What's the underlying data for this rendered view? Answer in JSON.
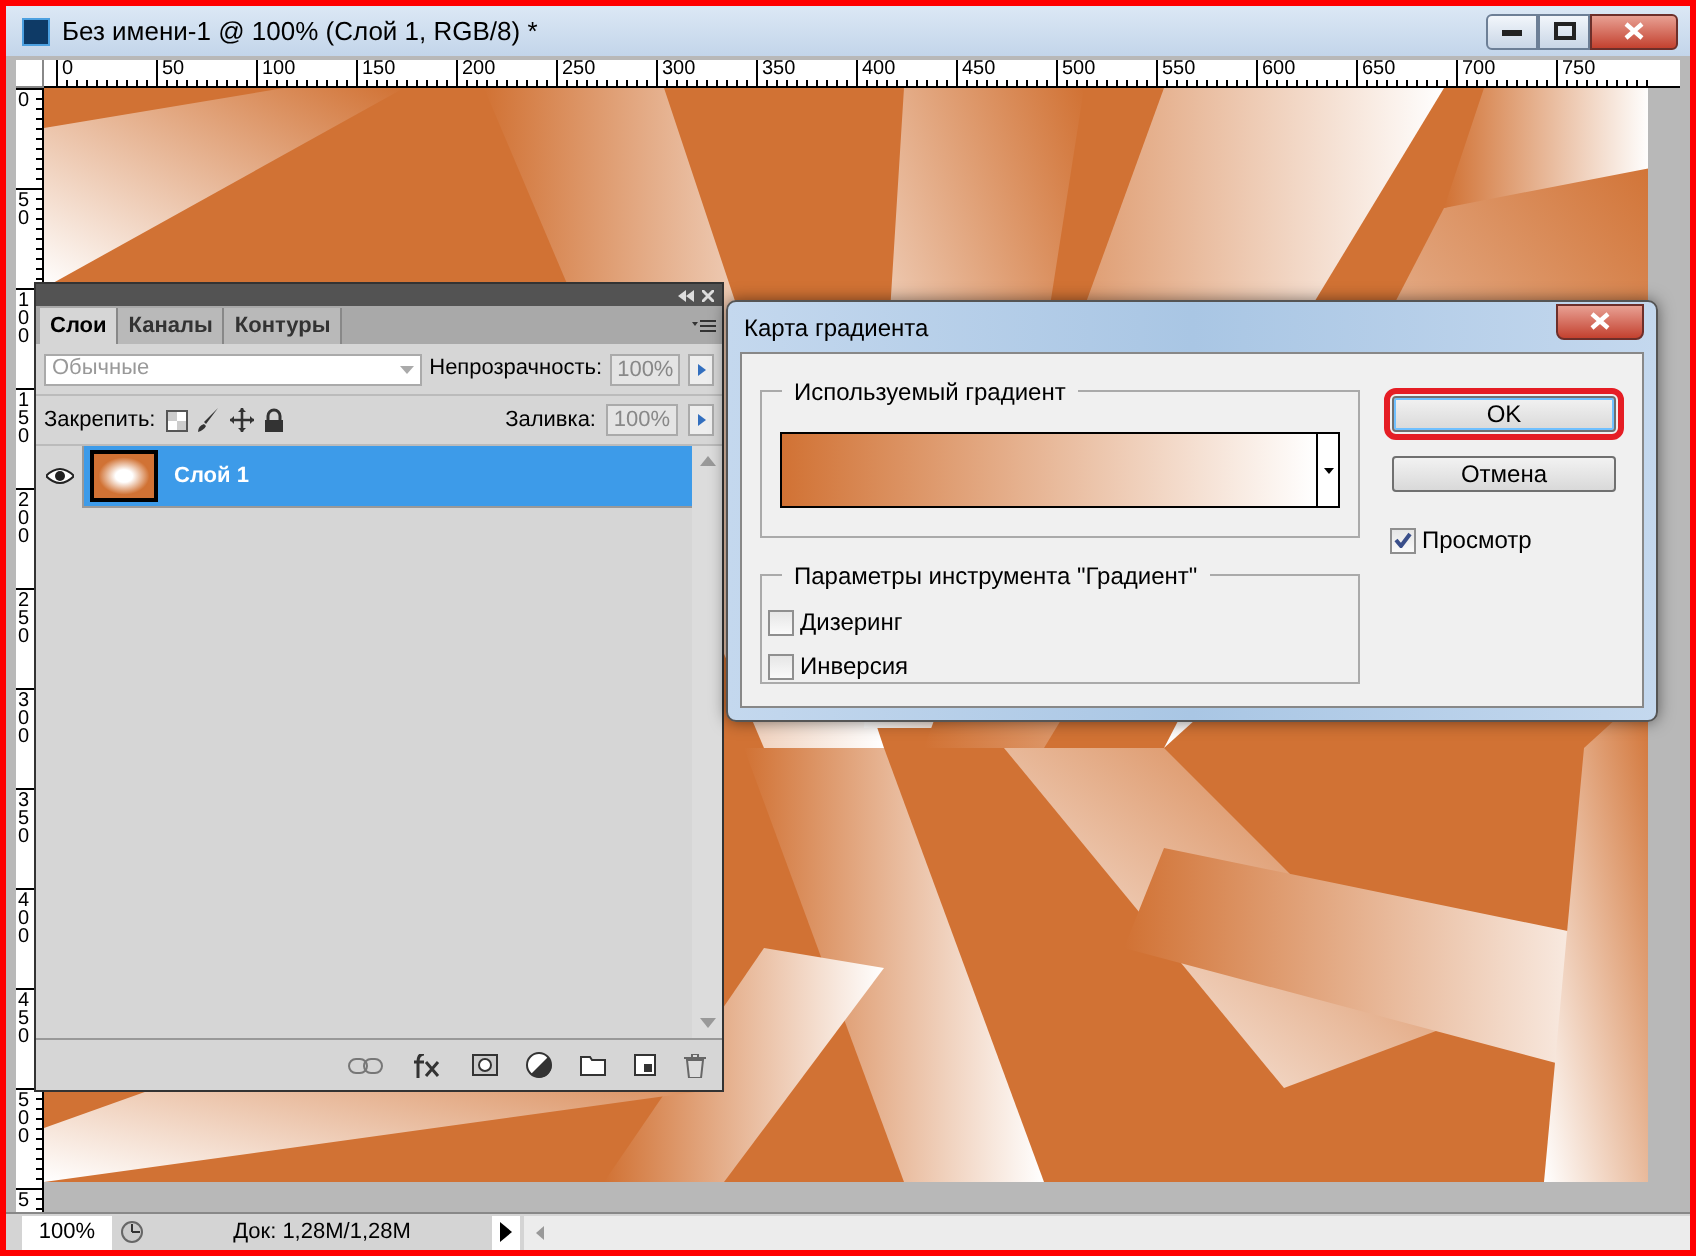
{
  "window": {
    "title": "Без имени-1 @ 100% (Слой 1, RGB/8) *"
  },
  "rulers": {
    "horizontal": [
      "0",
      "50",
      "100",
      "150",
      "200",
      "250",
      "300",
      "350",
      "400",
      "450",
      "500",
      "550",
      "600",
      "650",
      "700",
      "750"
    ],
    "vertical": [
      "0",
      "50",
      "100",
      "150",
      "200",
      "250",
      "300",
      "350",
      "400",
      "450",
      "500",
      "5"
    ]
  },
  "layers_panel": {
    "tabs": [
      {
        "label": "Слои",
        "selected": true
      },
      {
        "label": "Каналы",
        "selected": false
      },
      {
        "label": "Контуры",
        "selected": false
      }
    ],
    "blend_mode": {
      "placeholder": "Обычные"
    },
    "opacity": {
      "label": "Непрозрачность:",
      "value": "100%"
    },
    "lock": {
      "label": "Закрепить:"
    },
    "fill": {
      "label": "Заливка:",
      "value": "100%"
    },
    "layers": [
      {
        "name": "Слой 1",
        "visible": true,
        "selected": true
      }
    ]
  },
  "dialog": {
    "title": "Карта градиента",
    "gradient_group": {
      "title": "Используемый градиент"
    },
    "options_group": {
      "title": "Параметры инструмента \"Градиент\"",
      "checkboxes": [
        {
          "label": "Дизеринг",
          "checked": false
        },
        {
          "label": "Инверсия",
          "checked": false
        }
      ]
    },
    "buttons": [
      {
        "label": "OK",
        "highlighted": true
      },
      {
        "label": "Отмена",
        "highlighted": false
      }
    ],
    "preview": {
      "label": "Просмотр",
      "checked": true
    }
  },
  "status_bar": {
    "zoom": "100%",
    "doc": "Док: 1,28M/1,28M"
  }
}
